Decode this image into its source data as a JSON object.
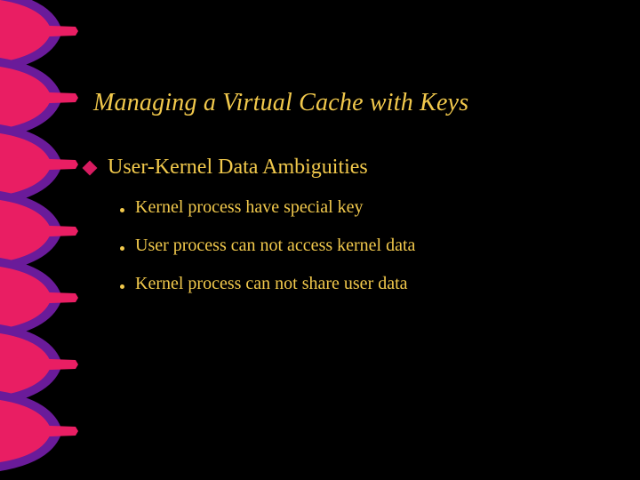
{
  "colors": {
    "title": "#f2c94c",
    "body": "#f2c94c",
    "bullet1": "#d81b60",
    "bullet2": "#f2c94c",
    "decorPurple": "#6a1b9a",
    "decorPink": "#e91e63"
  },
  "title": "Managing a Virtual Cache with Keys",
  "bullets": [
    {
      "text": "User-Kernel Data Ambiguities",
      "sub": [
        "Kernel process have special key",
        "User process can not access kernel data",
        "Kernel process can not share user data"
      ]
    }
  ]
}
